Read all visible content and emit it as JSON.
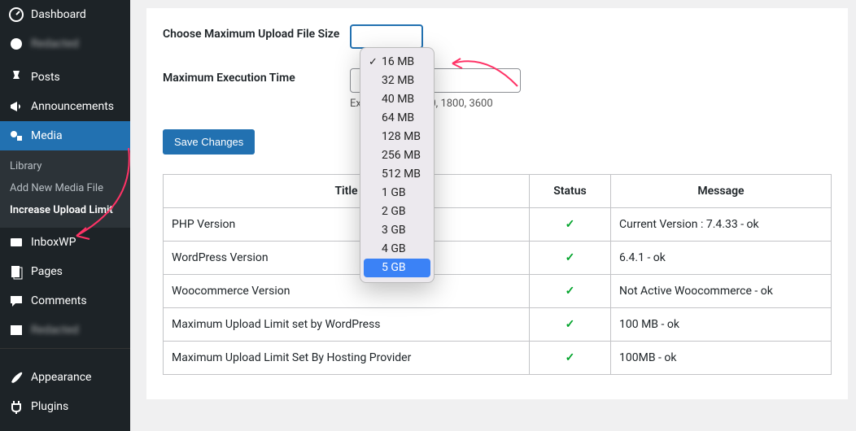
{
  "sidebar": {
    "items": [
      {
        "label": "Dashboard"
      },
      {
        "label": "Redacted"
      },
      {
        "label": "Posts"
      },
      {
        "label": "Announcements"
      },
      {
        "label": "Media"
      },
      {
        "label": "InboxWP"
      },
      {
        "label": "Pages"
      },
      {
        "label": "Comments"
      },
      {
        "label": "Redacted"
      },
      {
        "label": "Appearance"
      },
      {
        "label": "Plugins"
      }
    ],
    "submenu": {
      "library": "Library",
      "addnew": "Add New Media File",
      "increase": "Increase Upload Limit"
    }
  },
  "form": {
    "max_upload_label": "Choose Maximum Upload File Size",
    "exec_time_label": "Maximum Execution Time",
    "exec_time_value": "",
    "exec_hint": "Example: 300, 600, 1800, 3600",
    "save_label": "Save Changes"
  },
  "dropdown": {
    "options": [
      "16 MB",
      "32 MB",
      "40 MB",
      "64 MB",
      "128 MB",
      "256 MB",
      "512 MB",
      "1 GB",
      "2 GB",
      "3 GB",
      "4 GB",
      "5 GB"
    ],
    "checked": "16 MB",
    "highlight": "5 GB"
  },
  "table": {
    "headers": {
      "title": "Title",
      "status": "Status",
      "message": "Message"
    },
    "rows": [
      {
        "title": "PHP Version",
        "status": "ok",
        "message": "Current Version : 7.4.33 - ok"
      },
      {
        "title": "WordPress Version",
        "status": "ok",
        "message": "6.4.1 - ok"
      },
      {
        "title": "Woocommerce Version",
        "status": "ok",
        "message": "Not Active Woocommerce - ok"
      },
      {
        "title": "Maximum Upload Limit set by WordPress",
        "status": "ok",
        "message": "100 MB - ok"
      },
      {
        "title": "Maximum Upload Limit Set By Hosting Provider",
        "status": "ok",
        "message": "100MB - ok"
      }
    ]
  }
}
